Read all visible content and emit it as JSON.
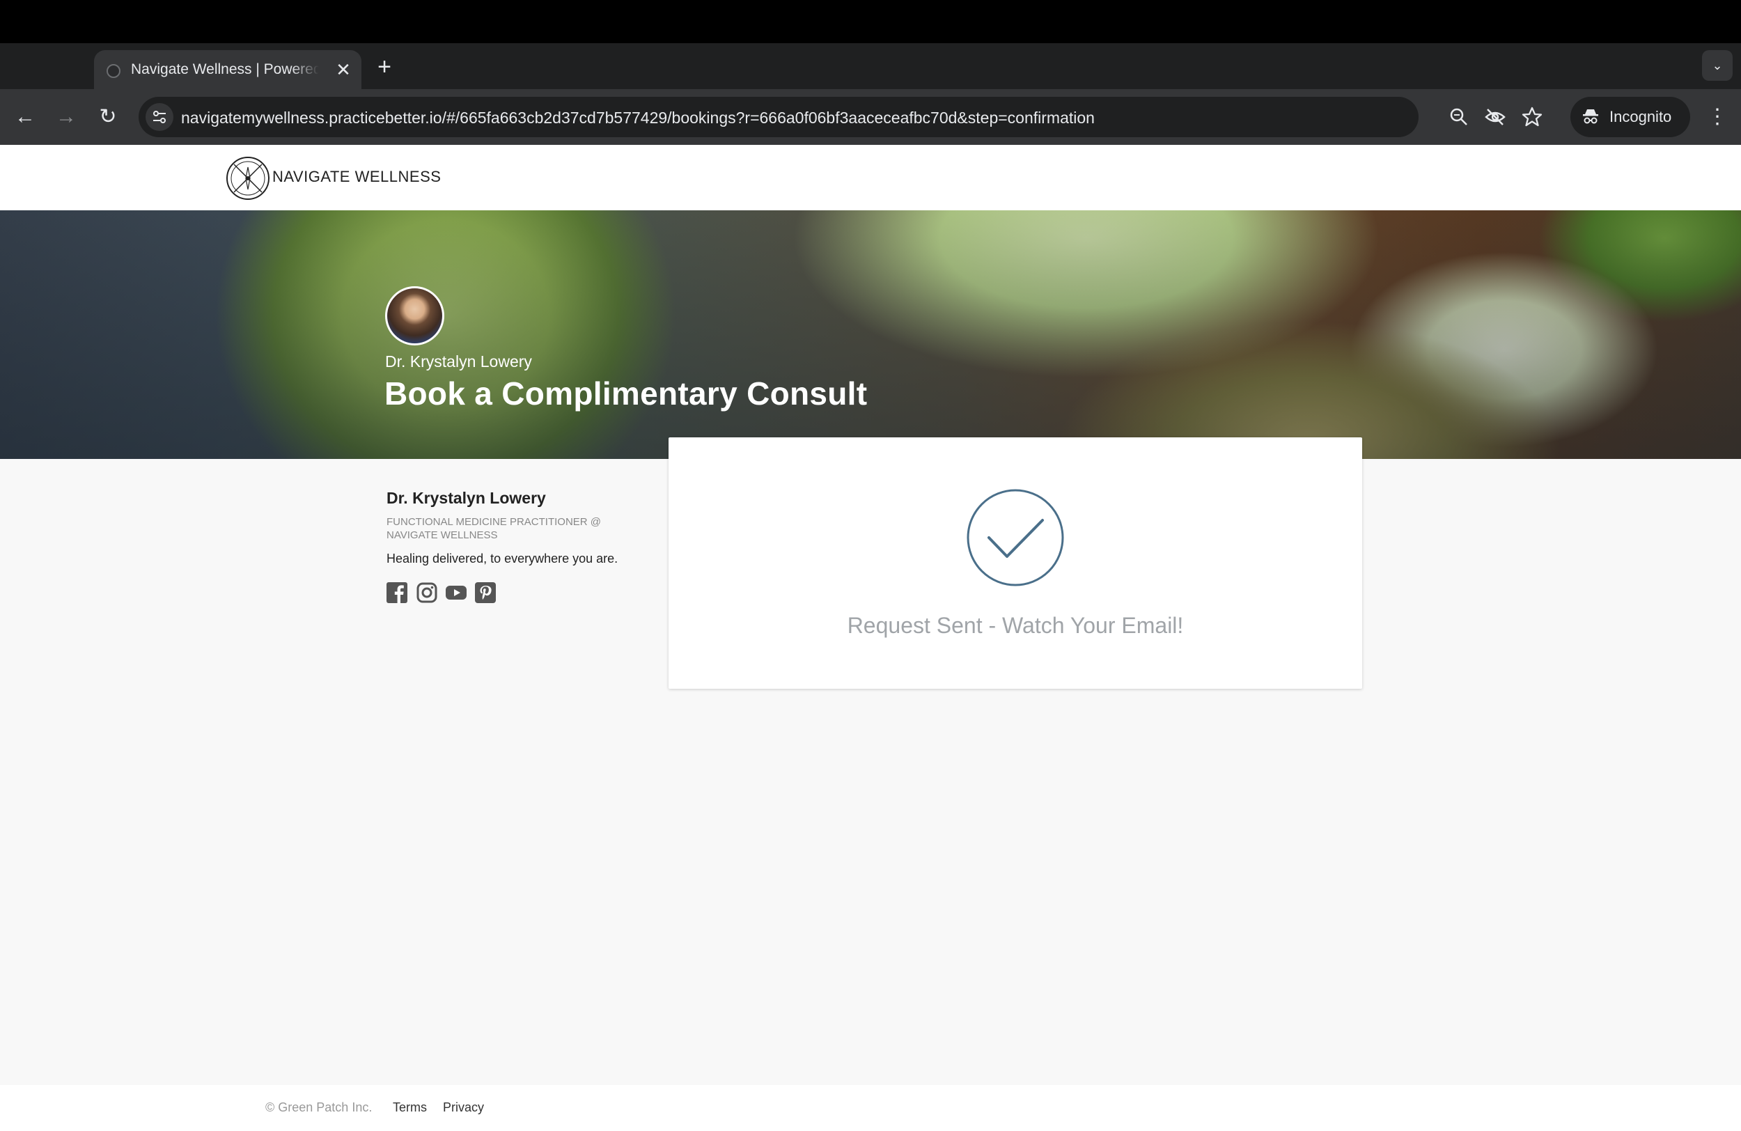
{
  "browser": {
    "tab_title": "Navigate Wellness | Powered by Practice Better",
    "tab_close": "✕",
    "new_tab": "+",
    "tab_search": "⌄",
    "back": "←",
    "forward": "→",
    "reload": "↻",
    "url": "navigatemywellness.practicebetter.io/#/665fa663cb2d37cd7b577429/bookings?r=666a0f06bf3aaceceafbc70d&step=confirmation",
    "incognito_label": "Incognito",
    "menu": "⋮",
    "icons": [
      "site-info-icon",
      "zoom-icon",
      "eye-off-icon",
      "bookmark-star-icon",
      "incognito-icon"
    ]
  },
  "site": {
    "brand_name": "NAVIGATE WELLNESS"
  },
  "hero": {
    "practitioner_name": "Dr. Krystalyn Lowery",
    "title": "Book a Complimentary Consult"
  },
  "profile": {
    "name": "Dr. Krystalyn Lowery",
    "role": "FUNCTIONAL MEDICINE PRACTITIONER @ NAVIGATE WELLNESS",
    "tagline": "Healing delivered, to everywhere you are.",
    "social": [
      "facebook-icon",
      "instagram-icon",
      "youtube-icon",
      "pinterest-icon"
    ]
  },
  "confirmation": {
    "message": "Request Sent - Watch Your Email!",
    "accent": "#4a6f8a"
  },
  "footer": {
    "copyright": "© Green Patch Inc.",
    "terms": "Terms",
    "privacy": "Privacy"
  }
}
